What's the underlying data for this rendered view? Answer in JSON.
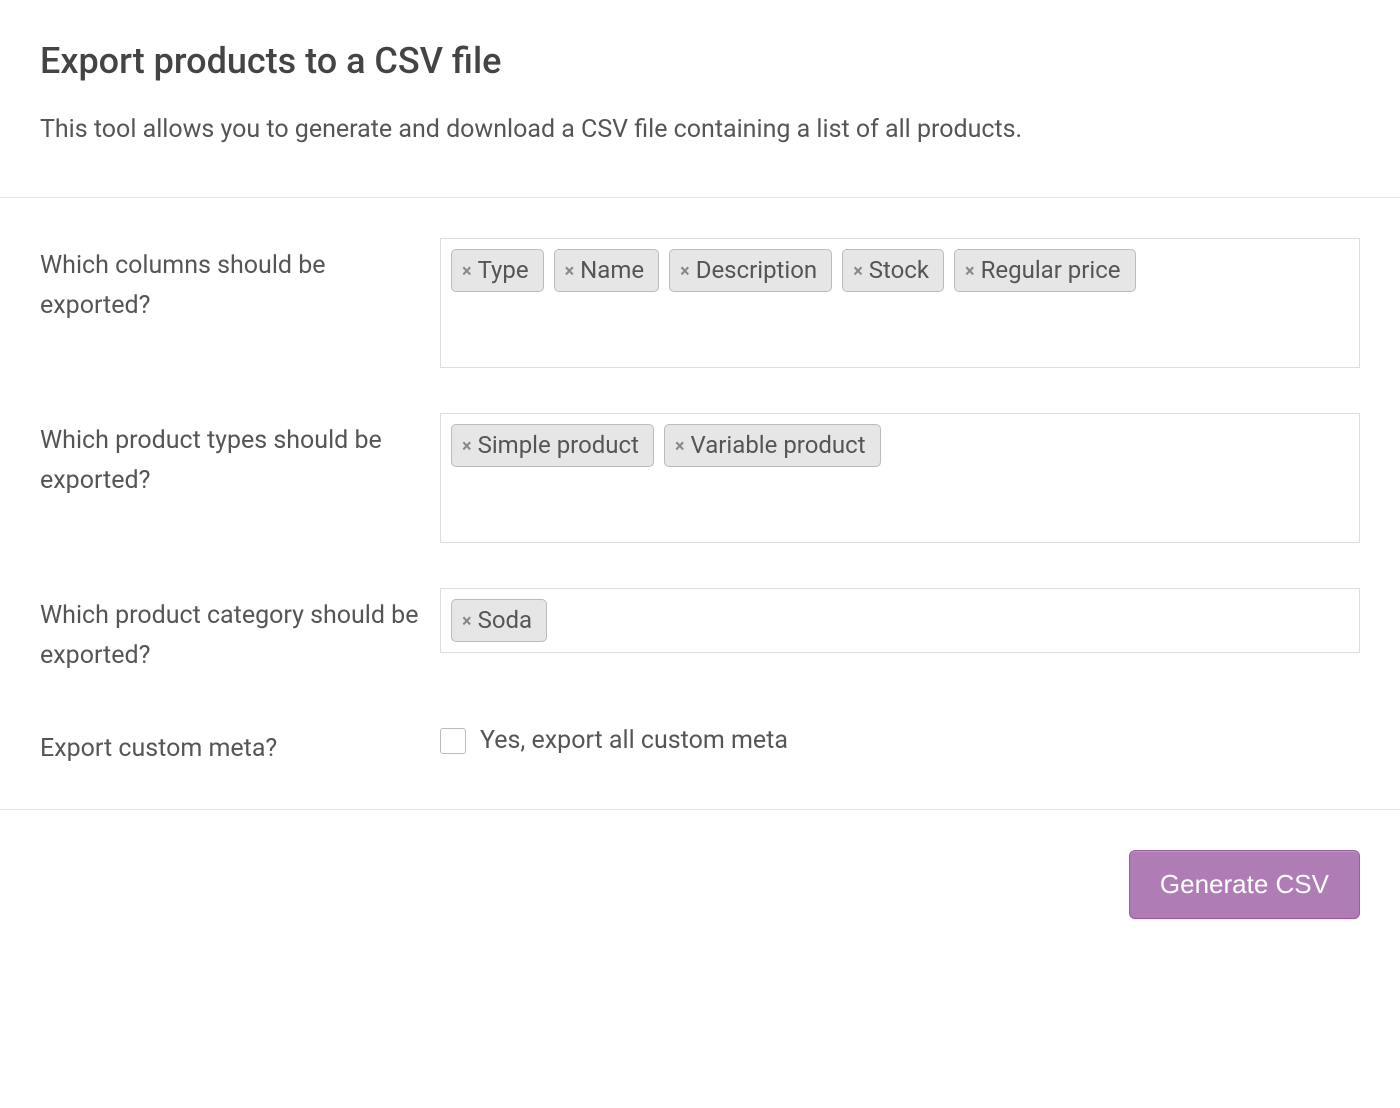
{
  "header": {
    "title": "Export products to a CSV file",
    "description": "This tool allows you to generate and download a CSV file containing a list of all products."
  },
  "fields": {
    "columns": {
      "label": "Which columns should be exported?",
      "tags": [
        "Type",
        "Name",
        "Description",
        "Stock",
        "Regular price"
      ]
    },
    "types": {
      "label": "Which product types should be exported?",
      "tags": [
        "Simple product",
        "Variable product"
      ]
    },
    "category": {
      "label": "Which product category should be exported?",
      "tags": [
        "Soda"
      ]
    },
    "meta": {
      "label": "Export custom meta?",
      "checkbox_label": "Yes, export all custom meta",
      "checked": false
    }
  },
  "actions": {
    "generate_label": "Generate CSV"
  }
}
